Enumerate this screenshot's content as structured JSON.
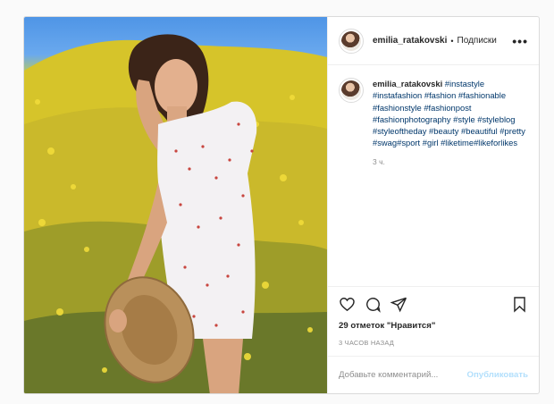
{
  "post": {
    "username": "emilia_ratakovski",
    "separator": "•",
    "follow_label": "Подписки",
    "more_label": "•••"
  },
  "caption": {
    "username": "emilia_ratakovski",
    "hashtags": "#instastyle #instafashion #fashion #fashionable #fashionstyle #fashionpost #fashionphotography #style #styleblog #styleoftheday #beauty #beautiful #pretty #swag#sport #girl #liketime#likeforlikes",
    "time": "3 ч."
  },
  "actions": {
    "likes": "29 отметок \"Нравится\"",
    "time_ago": "3 часов назад",
    "icons": [
      "heart-icon",
      "comment-icon",
      "share-icon",
      "bookmark-icon"
    ]
  },
  "comment_box": {
    "placeholder": "Добавьте комментарий...",
    "publish_label": "Опубликовать"
  },
  "colors": {
    "link": "#00376b",
    "muted": "#8e8e8e",
    "publish_disabled": "#b2dffc",
    "border": "#dbdbdb"
  }
}
